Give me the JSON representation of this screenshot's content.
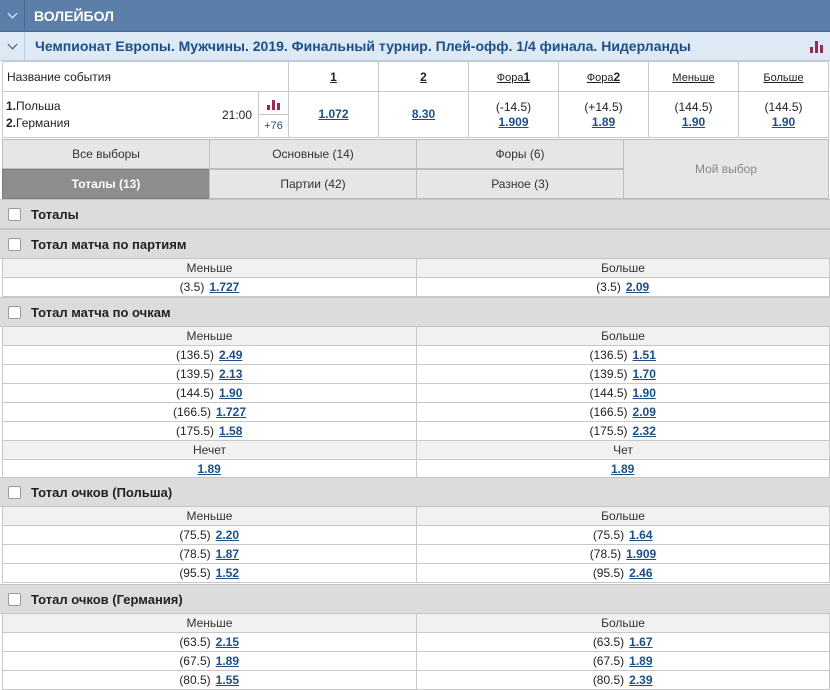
{
  "sport": {
    "title": "ВОЛЕЙБОЛ"
  },
  "league": {
    "title": "Чемпионат Европы. Мужчины. 2019. Финальный турнир. Плей-офф. 1/4 финала. Нидерланды"
  },
  "table_head": {
    "name": "Название события",
    "c1": "1",
    "c2": "2",
    "fora1_text": "Фора",
    "fora1_num": "1",
    "fora2_text": "Фора",
    "fora2_num": "2",
    "less": "Меньше",
    "more": "Больше"
  },
  "event": {
    "team1_num": "1.",
    "team1": "Польша",
    "team2_num": "2.",
    "team2": "Германия",
    "time": "21:00",
    "more_count": "+76",
    "odd1": "1.072",
    "odd2": "8.30",
    "fora1_param": "(-14.5)",
    "fora1_odd": "1.909",
    "fora2_param": "(+14.5)",
    "fora2_odd": "1.89",
    "less_param": "(144.5)",
    "less_odd": "1.90",
    "more_param": "(144.5)",
    "more_odd": "1.90"
  },
  "filters": {
    "all": "Все выборы",
    "main": "Основные (14)",
    "foras": "Форы (6)",
    "mine": "Мой выбор",
    "totals": "Тоталы (13)",
    "sets": "Партии (42)",
    "misc": "Разное (3)"
  },
  "sections": {
    "totals": "Тоталы",
    "by_sets": {
      "title": "Тотал матча по партиям",
      "head_left": "Меньше",
      "head_right": "Больше",
      "rows": [
        {
          "lp": "(3.5)",
          "lo": "1.727",
          "rp": "(3.5)",
          "ro": "2.09"
        }
      ]
    },
    "by_points": {
      "title": "Тотал матча по очкам",
      "head_left": "Меньше",
      "head_right": "Больше",
      "rows": [
        {
          "lp": "(136.5)",
          "lo": "2.49",
          "rp": "(136.5)",
          "ro": "1.51"
        },
        {
          "lp": "(139.5)",
          "lo": "2.13",
          "rp": "(139.5)",
          "ro": "1.70"
        },
        {
          "lp": "(144.5)",
          "lo": "1.90",
          "rp": "(144.5)",
          "ro": "1.90"
        },
        {
          "lp": "(166.5)",
          "lo": "1.727",
          "rp": "(166.5)",
          "ro": "2.09"
        },
        {
          "lp": "(175.5)",
          "lo": "1.58",
          "rp": "(175.5)",
          "ro": "2.32"
        }
      ],
      "odd_head": "Нечет",
      "even_head": "Чет",
      "odd_val": "1.89",
      "even_val": "1.89"
    },
    "poland": {
      "title": "Тотал очков (Польша)",
      "head_left": "Меньше",
      "head_right": "Больше",
      "rows": [
        {
          "lp": "(75.5)",
          "lo": "2.20",
          "rp": "(75.5)",
          "ro": "1.64"
        },
        {
          "lp": "(78.5)",
          "lo": "1.87",
          "rp": "(78.5)",
          "ro": "1.909"
        },
        {
          "lp": "(95.5)",
          "lo": "1.52",
          "rp": "(95.5)",
          "ro": "2.46"
        }
      ]
    },
    "germany": {
      "title": "Тотал очков (Германия)",
      "head_left": "Меньше",
      "head_right": "Больше",
      "rows": [
        {
          "lp": "(63.5)",
          "lo": "2.15",
          "rp": "(63.5)",
          "ro": "1.67"
        },
        {
          "lp": "(67.5)",
          "lo": "1.89",
          "rp": "(67.5)",
          "ro": "1.89"
        },
        {
          "lp": "(80.5)",
          "lo": "1.55",
          "rp": "(80.5)",
          "ro": "2.39"
        }
      ]
    }
  }
}
